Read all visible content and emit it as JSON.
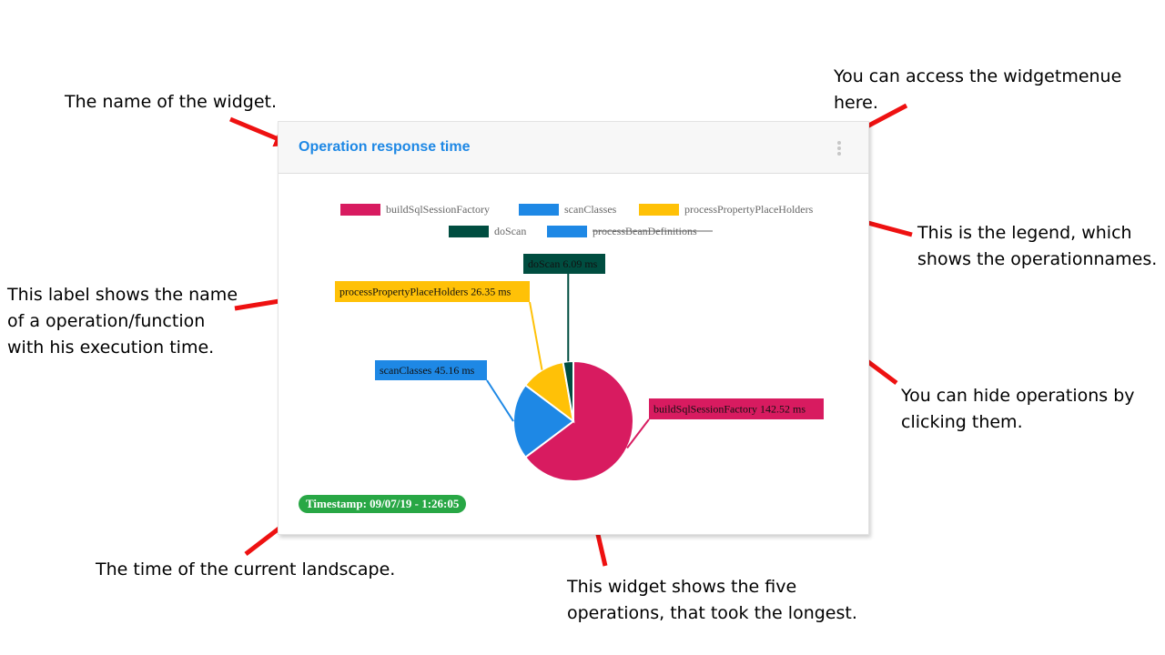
{
  "annotations": {
    "widget_name": "The name of the widget.",
    "menu_access": "You can access the widgetmenue\nhere.",
    "label_explain": "This label shows the name\nof a operation/function\nwith his execution time.",
    "legend_explain": "This is the legend, which\nshows the operationnames.",
    "hide_explain": "You can hide operations by\nclicking them.",
    "timestamp_explain": "The time of the current landscape.",
    "widget_explain": "This widget shows the five\noperations, that took the longest."
  },
  "widget": {
    "title": "Operation response time",
    "menu_icon": "vertical-ellipsis-icon",
    "timestamp": "Timestamp: 09/07/19 - 1:26:05"
  },
  "colors": {
    "annotation_arrow": "#ee1111",
    "title": "#1e88e5",
    "timestamp_bg": "#28a745"
  },
  "chart_data": {
    "type": "pie",
    "legend_position": "top",
    "unit": "ms",
    "series": [
      {
        "name": "buildSqlSessionFactory",
        "value": 142.52,
        "label": "buildSqlSessionFactory 142.52 ms",
        "color": "#d81b60",
        "hidden": false
      },
      {
        "name": "scanClasses",
        "value": 45.16,
        "label": "scanClasses 45.16 ms",
        "color": "#1e88e5",
        "hidden": false
      },
      {
        "name": "processPropertyPlaceHolders",
        "value": 26.35,
        "label": "processPropertyPlaceHolders 26.35 ms",
        "color": "#ffc107",
        "hidden": false
      },
      {
        "name": "doScan",
        "value": 6.09,
        "label": "doScan 6.09 ms",
        "color": "#004d40",
        "hidden": false
      },
      {
        "name": "processBeanDefinitions",
        "value": null,
        "label": "",
        "color": "#1e88e5",
        "hidden": true
      }
    ]
  }
}
